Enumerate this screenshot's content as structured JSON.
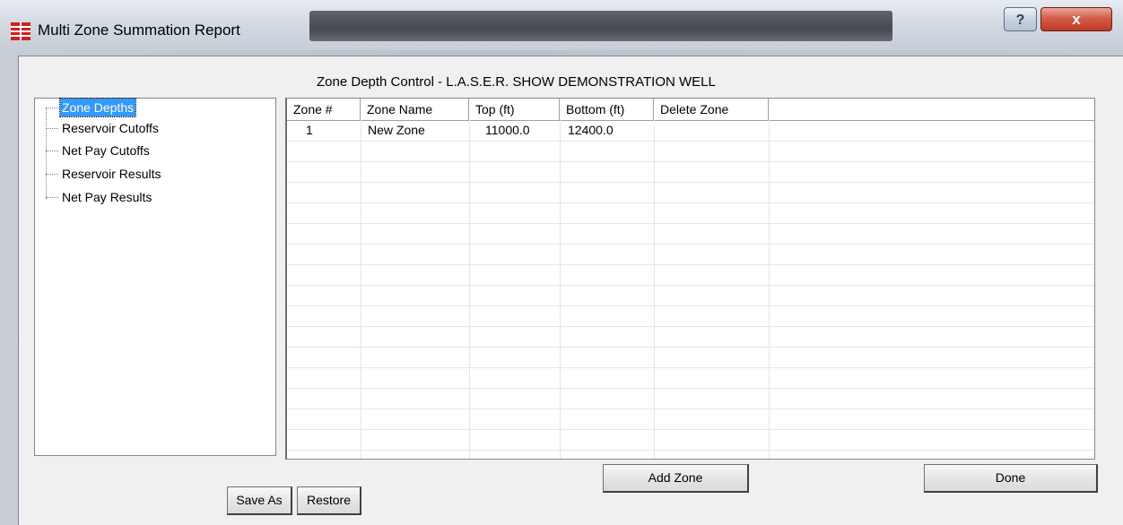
{
  "window": {
    "title": "Multi Zone Summation Report",
    "help_label": "?",
    "close_label": "x"
  },
  "header": {
    "label": "Zone Depth Control - L.A.S.E.R. SHOW DEMONSTRATION WELL"
  },
  "tree": {
    "items": [
      {
        "label": "Zone Depths",
        "selected": true
      },
      {
        "label": "Reservoir Cutoffs",
        "selected": false
      },
      {
        "label": "Net Pay Cutoffs",
        "selected": false
      },
      {
        "label": "Reservoir Results",
        "selected": false
      },
      {
        "label": "Net Pay Results",
        "selected": false
      }
    ]
  },
  "grid": {
    "columns": [
      "Zone #",
      "Zone Name",
      "Top (ft)",
      "Bottom (ft)",
      "Delete Zone"
    ],
    "rows": [
      {
        "zone_num": "1",
        "zone_name": "New Zone",
        "top": "11000.0",
        "bottom": "12400.0",
        "delete": ""
      }
    ]
  },
  "buttons": {
    "add_zone": "Add Zone",
    "done": "Done",
    "save_as": "Save As",
    "restore": "Restore"
  },
  "colors": {
    "selection": "#3399ff",
    "close_button": "#c7452d"
  }
}
